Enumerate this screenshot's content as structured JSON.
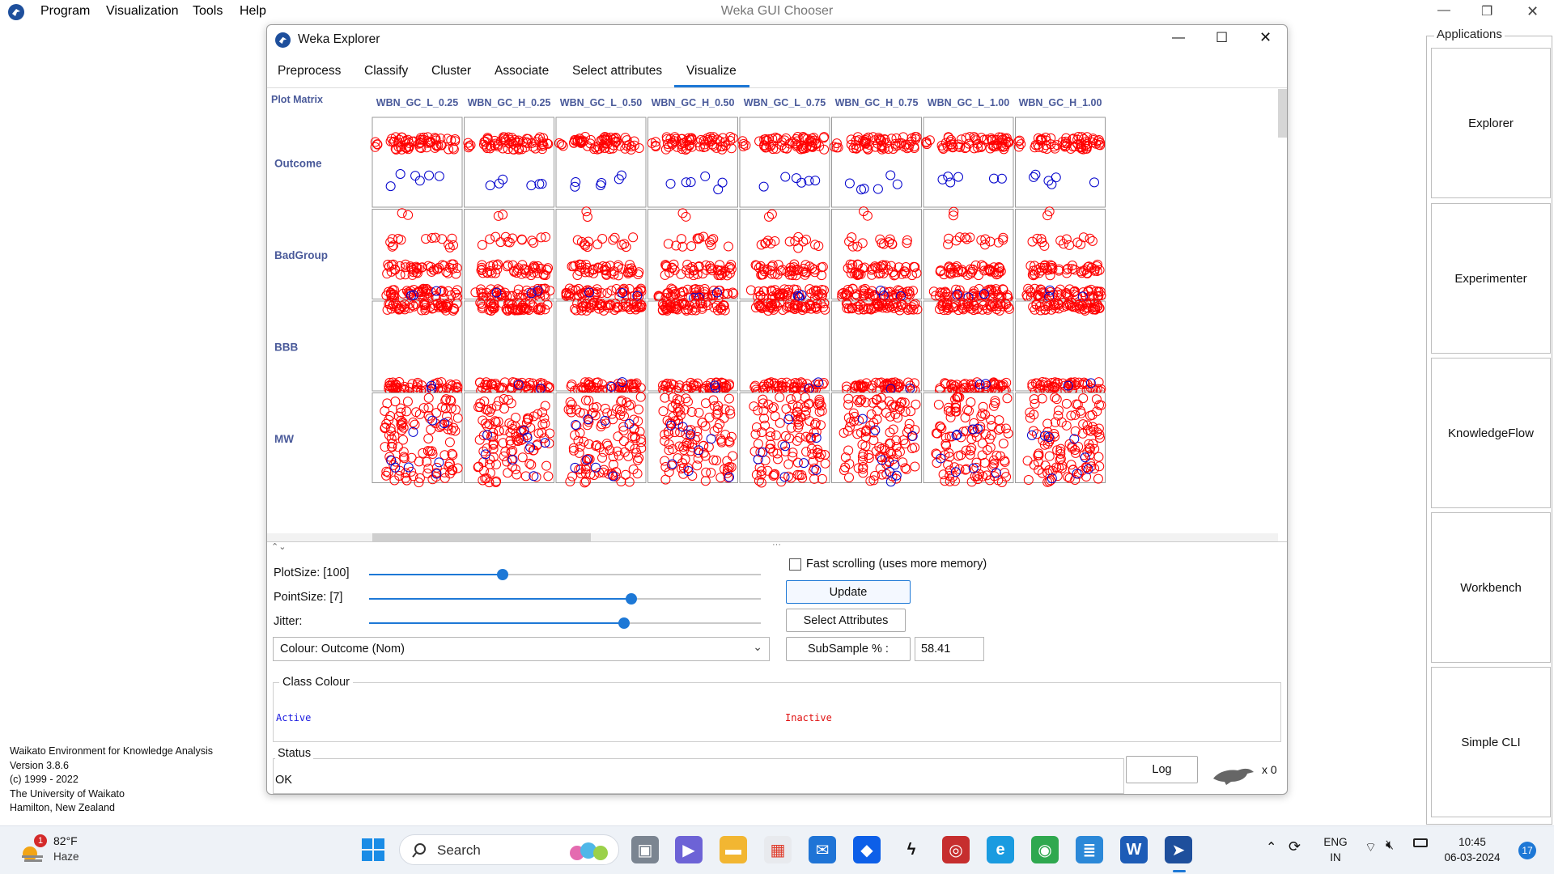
{
  "chooser": {
    "menu": [
      "Program",
      "Visualization",
      "Tools",
      "Help"
    ],
    "title": "Weka GUI Chooser",
    "applications_label": "Applications",
    "applications": [
      "Explorer",
      "Experimenter",
      "KnowledgeFlow",
      "Workbench",
      "Simple CLI"
    ],
    "info": [
      "Waikato Environment for Knowledge Analysis",
      "Version 3.8.6",
      "(c) 1999 - 2022",
      "The University of Waikato",
      "Hamilton, New Zealand"
    ]
  },
  "explorer": {
    "title": "Weka Explorer",
    "tabs": [
      "Preprocess",
      "Classify",
      "Cluster",
      "Associate",
      "Select attributes",
      "Visualize"
    ],
    "active_tab": "Visualize",
    "plot_matrix": {
      "label": "Plot Matrix",
      "columns": [
        "WBN_GC_L_0.25",
        "WBN_GC_H_0.25",
        "WBN_GC_L_0.50",
        "WBN_GC_H_0.50",
        "WBN_GC_L_0.75",
        "WBN_GC_H_0.75",
        "WBN_GC_L_1.00",
        "WBN_GC_H_1.00"
      ],
      "rows": [
        "Outcome",
        "BadGroup",
        "BBB",
        "MW"
      ]
    },
    "controls": {
      "plot_size_label": "PlotSize: [100]",
      "plot_size_value": 100,
      "plot_size_fraction": 0.34,
      "point_size_label": "PointSize: [7]",
      "point_size_value": 7,
      "point_size_fraction": 0.67,
      "jitter_label": "Jitter:",
      "jitter_fraction": 0.65,
      "colour_select": "Colour: Outcome  (Nom)",
      "fast_scrolling_label": "Fast scrolling (uses more memory)",
      "fast_scrolling_checked": false,
      "update_label": "Update",
      "select_attributes_label": "Select Attributes",
      "subsample_label": "SubSample % :",
      "subsample_value": "58.41"
    },
    "class_colour": {
      "label": "Class Colour",
      "classes": [
        {
          "name": "Active",
          "color": "#1a1ae0"
        },
        {
          "name": "Inactive",
          "color": "#e01010"
        }
      ]
    },
    "status": {
      "label": "Status",
      "text": "OK",
      "log_label": "Log",
      "task_count": "x 0"
    },
    "colors": {
      "accent": "#1d78d6",
      "header_text": "#4a5a9a",
      "inactive_points": "#ff0000",
      "active_points": "#0000cc"
    }
  },
  "taskbar": {
    "weather_temp": "82°F",
    "weather_desc": "Haze",
    "weather_badge": "1",
    "search_label": "Search",
    "lang_line1": "ENG",
    "lang_line2": "IN",
    "time": "10:45",
    "date": "06-03-2024",
    "notification_count": "17"
  }
}
